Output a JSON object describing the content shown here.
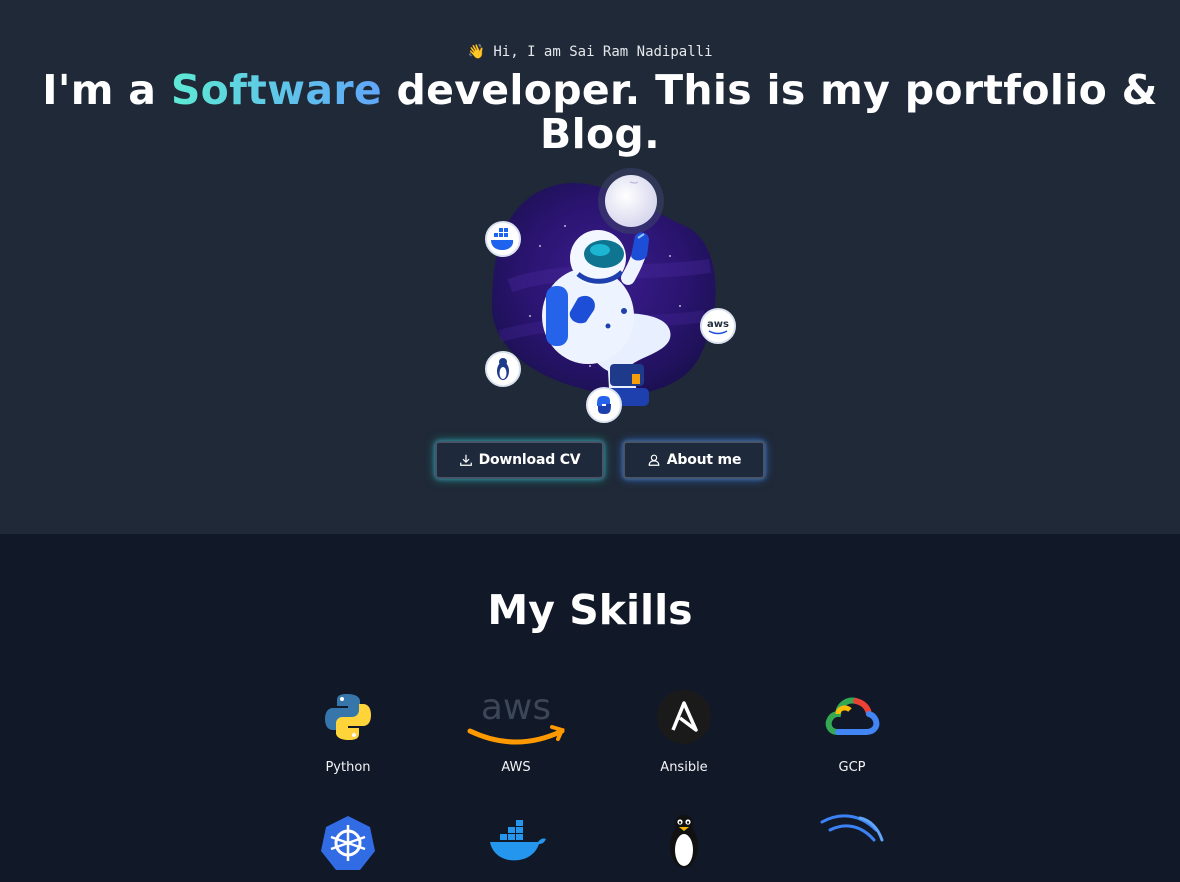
{
  "hero": {
    "greeting_emoji": "👋",
    "greeting": "Hi, I am Sai Ram Nadipalli",
    "headline_pre": "I'm a ",
    "headline_accent": "Software",
    "headline_post": " developer. This is my portfolio & Blog.",
    "illustration_badges": [
      "docker-icon",
      "aws-icon",
      "linux-icon",
      "python-icon"
    ]
  },
  "buttons": {
    "download_cv": "Download CV",
    "about_me": "About me"
  },
  "skills": {
    "title": "My Skills",
    "items": [
      {
        "label": "Python",
        "icon": "python-icon"
      },
      {
        "label": "AWS",
        "icon": "aws-icon"
      },
      {
        "label": "Ansible",
        "icon": "ansible-icon"
      },
      {
        "label": "GCP",
        "icon": "gcp-icon"
      },
      {
        "label": "",
        "icon": "kubernetes-icon"
      },
      {
        "label": "",
        "icon": "docker-icon"
      },
      {
        "label": "",
        "icon": "linux-icon"
      },
      {
        "label": "",
        "icon": "terraform-wave-icon"
      }
    ]
  },
  "colors": {
    "hero_bg": "#1f2937",
    "page_bg": "#111827",
    "accent_start": "#5eead4",
    "accent_end": "#60a5fa"
  }
}
